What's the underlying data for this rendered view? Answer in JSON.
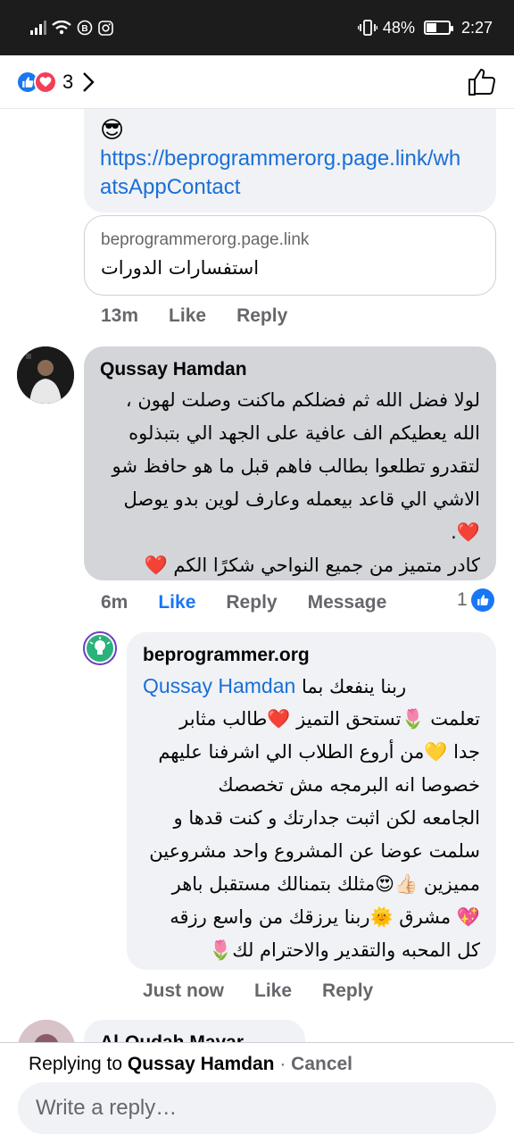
{
  "status": {
    "battery": "48%",
    "time": "2:27",
    "battery_level": 0.48
  },
  "reactions": {
    "count": "3"
  },
  "comment1": {
    "emoji": "😎",
    "link": "https://beprogrammerorg.page.link/whatsAppContact",
    "preview_domain": "beprogrammerorg.page.link",
    "preview_title": "استفسارات الدورات",
    "time": "13m",
    "like": "Like",
    "reply": "Reply"
  },
  "comment2": {
    "author": "Qussay Hamdan",
    "lines": [
      "لولا فضل الله ثم فضلكم ماكنت وصلت لهون ،",
      "الله يعطيكم الف عافية على الجهد الي بتبذلوه",
      "لتقدرو تطلعوا بطالب فاهم قبل ما هو حافظ شو",
      "الاشي الي قاعد بيعمله وعارف لوين بدو يوصل",
      "❤️.",
      "كادر متميز من جميع النواحي شكرًا الكم ❤️"
    ],
    "time": "6m",
    "like": "Like",
    "reply": "Reply",
    "message": "Message",
    "like_count": "1"
  },
  "comment3": {
    "author": "beprogrammer.org",
    "mention": "Qussay Hamdan",
    "first_line": "ربنا ينفعك بما",
    "lines": [
      "تعلمت 🌷تستحق التميز ❤️طالب مثابر",
      "جدا 💛من أروع الطلاب الي اشرفنا عليهم",
      "خصوصا انه البرمجه مش تخصصك",
      "الجامعه لكن اثبت جدارتك و كنت قدها و",
      "سلمت عوضا عن المشروع واحد مشروعين",
      "مميزين 👍🏻😍مثلك بتمنالك مستقبل باهر",
      "💖 مشرق 🌞ربنا يرزقك من واسع رزقه",
      "كل المحبه والتقدير والاحترام لك🌷"
    ],
    "time": "Just now",
    "like": "Like",
    "reply": "Reply"
  },
  "next_comment": {
    "author": "Al-Qudah Mayar"
  },
  "reply_bar": {
    "prefix": "Replying to ",
    "target": "Qussay Hamdan",
    "sep": " · ",
    "cancel": "Cancel",
    "placeholder": "Write a reply…"
  },
  "colors": {
    "accent": "#1877f2",
    "link": "#1a6fd6",
    "bubble": "#f0f2f5",
    "bubble_selected": "#d3d5d9"
  }
}
